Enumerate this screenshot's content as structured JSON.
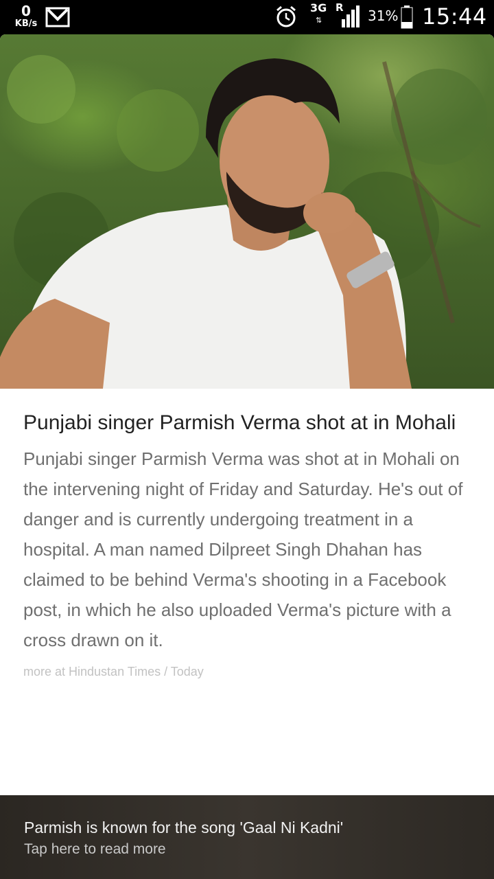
{
  "status_bar": {
    "speed_value": "0",
    "speed_unit": "KB/s",
    "network_type": "3G",
    "network_arrows": "⇅",
    "roaming": "R",
    "battery_percent": "31%",
    "time": "15:44",
    "icons": [
      "gmail-icon",
      "alarm-icon",
      "signal-icon",
      "battery-icon"
    ]
  },
  "article": {
    "headline": "Punjabi singer Parmish Verma shot at in Mohali",
    "body": "Punjabi singer Parmish Verma was shot at in Mohali on the intervening night of Friday and Saturday. He's out of danger and is currently undergoing treatment in a hospital. A man named Dilpreet Singh Dhahan has claimed to be behind Verma's shooting in a Facebook post, in which he also uploaded Verma's picture with a cross drawn on it.",
    "source": "more at Hindustan Times / Today"
  },
  "footer": {
    "title": "Parmish is known for the song 'Gaal Ni Kadni'",
    "subtitle": "Tap here to read more"
  },
  "colors": {
    "headline": "#222222",
    "body": "#6f6f6f",
    "source": "#c2c2c2",
    "footer_bg": "#35302a"
  }
}
